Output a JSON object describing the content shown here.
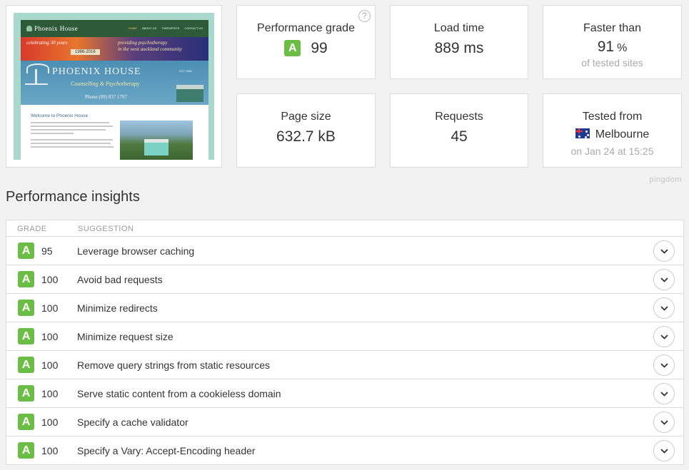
{
  "thumbnail": {
    "site_name": "Phoenix House",
    "nav_links": [
      "HOME",
      "ABOUT US",
      "THERAPISTS",
      "CONTACT US"
    ],
    "banner_left": "celebrating 30 years",
    "banner_years": "1986-2016",
    "banner_right_1": "providing psychotherapy",
    "banner_right_2": "in the west auckland community",
    "hero_name": "PHOENIX HOUSE",
    "hero_est": "EST 1986",
    "hero_sub": "Counselling & Psychotherapy",
    "hero_phone": "Phone (09) 837 1797",
    "welcome": "Welcome to Phoenix House"
  },
  "stats": {
    "grade": {
      "label": "Performance grade",
      "letter": "A",
      "value": "99",
      "help": "?"
    },
    "load": {
      "label": "Load time",
      "value": "889 ms"
    },
    "faster": {
      "label": "Faster than",
      "value": "91",
      "unit": "%",
      "sub": "of tested sites"
    },
    "size": {
      "label": "Page size",
      "value": "632.7 kB"
    },
    "requests": {
      "label": "Requests",
      "value": "45"
    },
    "tested": {
      "label": "Tested from",
      "city": "Melbourne",
      "when": "on Jan 24 at 15:25"
    }
  },
  "brand": "pingdom",
  "insights": {
    "title": "Performance insights",
    "col_grade": "GRADE",
    "col_suggestion": "SUGGESTION",
    "rows": [
      {
        "grade": "A",
        "score": "95",
        "text": "Leverage browser caching"
      },
      {
        "grade": "A",
        "score": "100",
        "text": "Avoid bad requests"
      },
      {
        "grade": "A",
        "score": "100",
        "text": "Minimize redirects"
      },
      {
        "grade": "A",
        "score": "100",
        "text": "Minimize request size"
      },
      {
        "grade": "A",
        "score": "100",
        "text": "Remove query strings from static resources"
      },
      {
        "grade": "A",
        "score": "100",
        "text": "Serve static content from a cookieless domain"
      },
      {
        "grade": "A",
        "score": "100",
        "text": "Specify a cache validator"
      },
      {
        "grade": "A",
        "score": "100",
        "text": "Specify a Vary: Accept-Encoding header"
      }
    ]
  }
}
